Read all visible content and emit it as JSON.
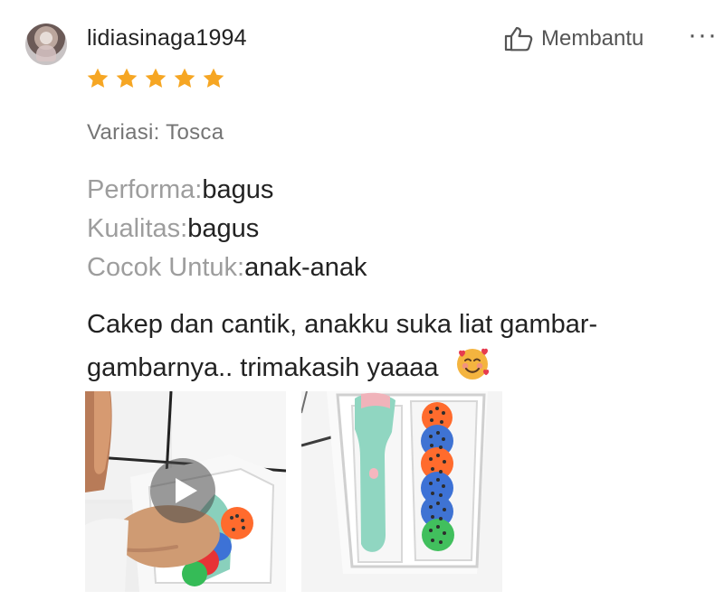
{
  "review": {
    "username": "lidiasinaga1994",
    "helpful_label": "Membantu",
    "more_label": "···",
    "rating": 5,
    "variation_text": "Variasi: Tosca",
    "metrics": [
      {
        "label": "Performa:",
        "value": "bagus"
      },
      {
        "label": "Kualitas:",
        "value": "bagus"
      },
      {
        "label": "Cocok Untuk:",
        "value": "anak-anak"
      }
    ],
    "comment": "Cakep dan cantik, anakku suka liat gambar-gambarnya.. trimakasih yaaaa",
    "comment_emoji": "smiling-face-with-hearts-icon",
    "media": [
      {
        "type": "video"
      },
      {
        "type": "photo"
      }
    ]
  },
  "colors": {
    "star": "#f6a623",
    "muted_label": "#9d9d9d",
    "variation": "#757575",
    "text": "#222222"
  }
}
